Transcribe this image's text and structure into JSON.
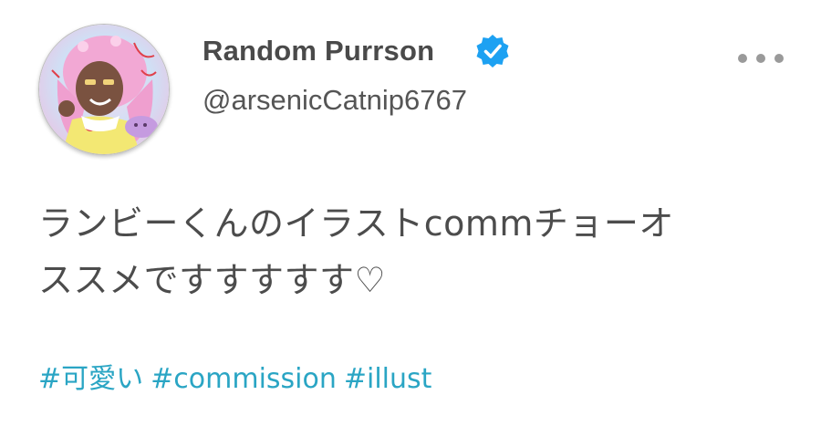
{
  "user": {
    "display_name": "Random Purrson",
    "handle": "@arsenicCatnip6767",
    "verified_icon": "verified-badge-icon",
    "avatar_icon": "avatar-illustration"
  },
  "menu": {
    "icon": "more-options-icon"
  },
  "tweet": {
    "line1": "ランビーくんのイラストcommチョーオ",
    "line2": "ススメですすすすす♡"
  },
  "hashtags": [
    "#可愛い",
    "#commission",
    "#illust"
  ],
  "colors": {
    "verified": "#1da1f2",
    "hashtag": "#2aa5c4",
    "text": "#4c4c4c"
  }
}
